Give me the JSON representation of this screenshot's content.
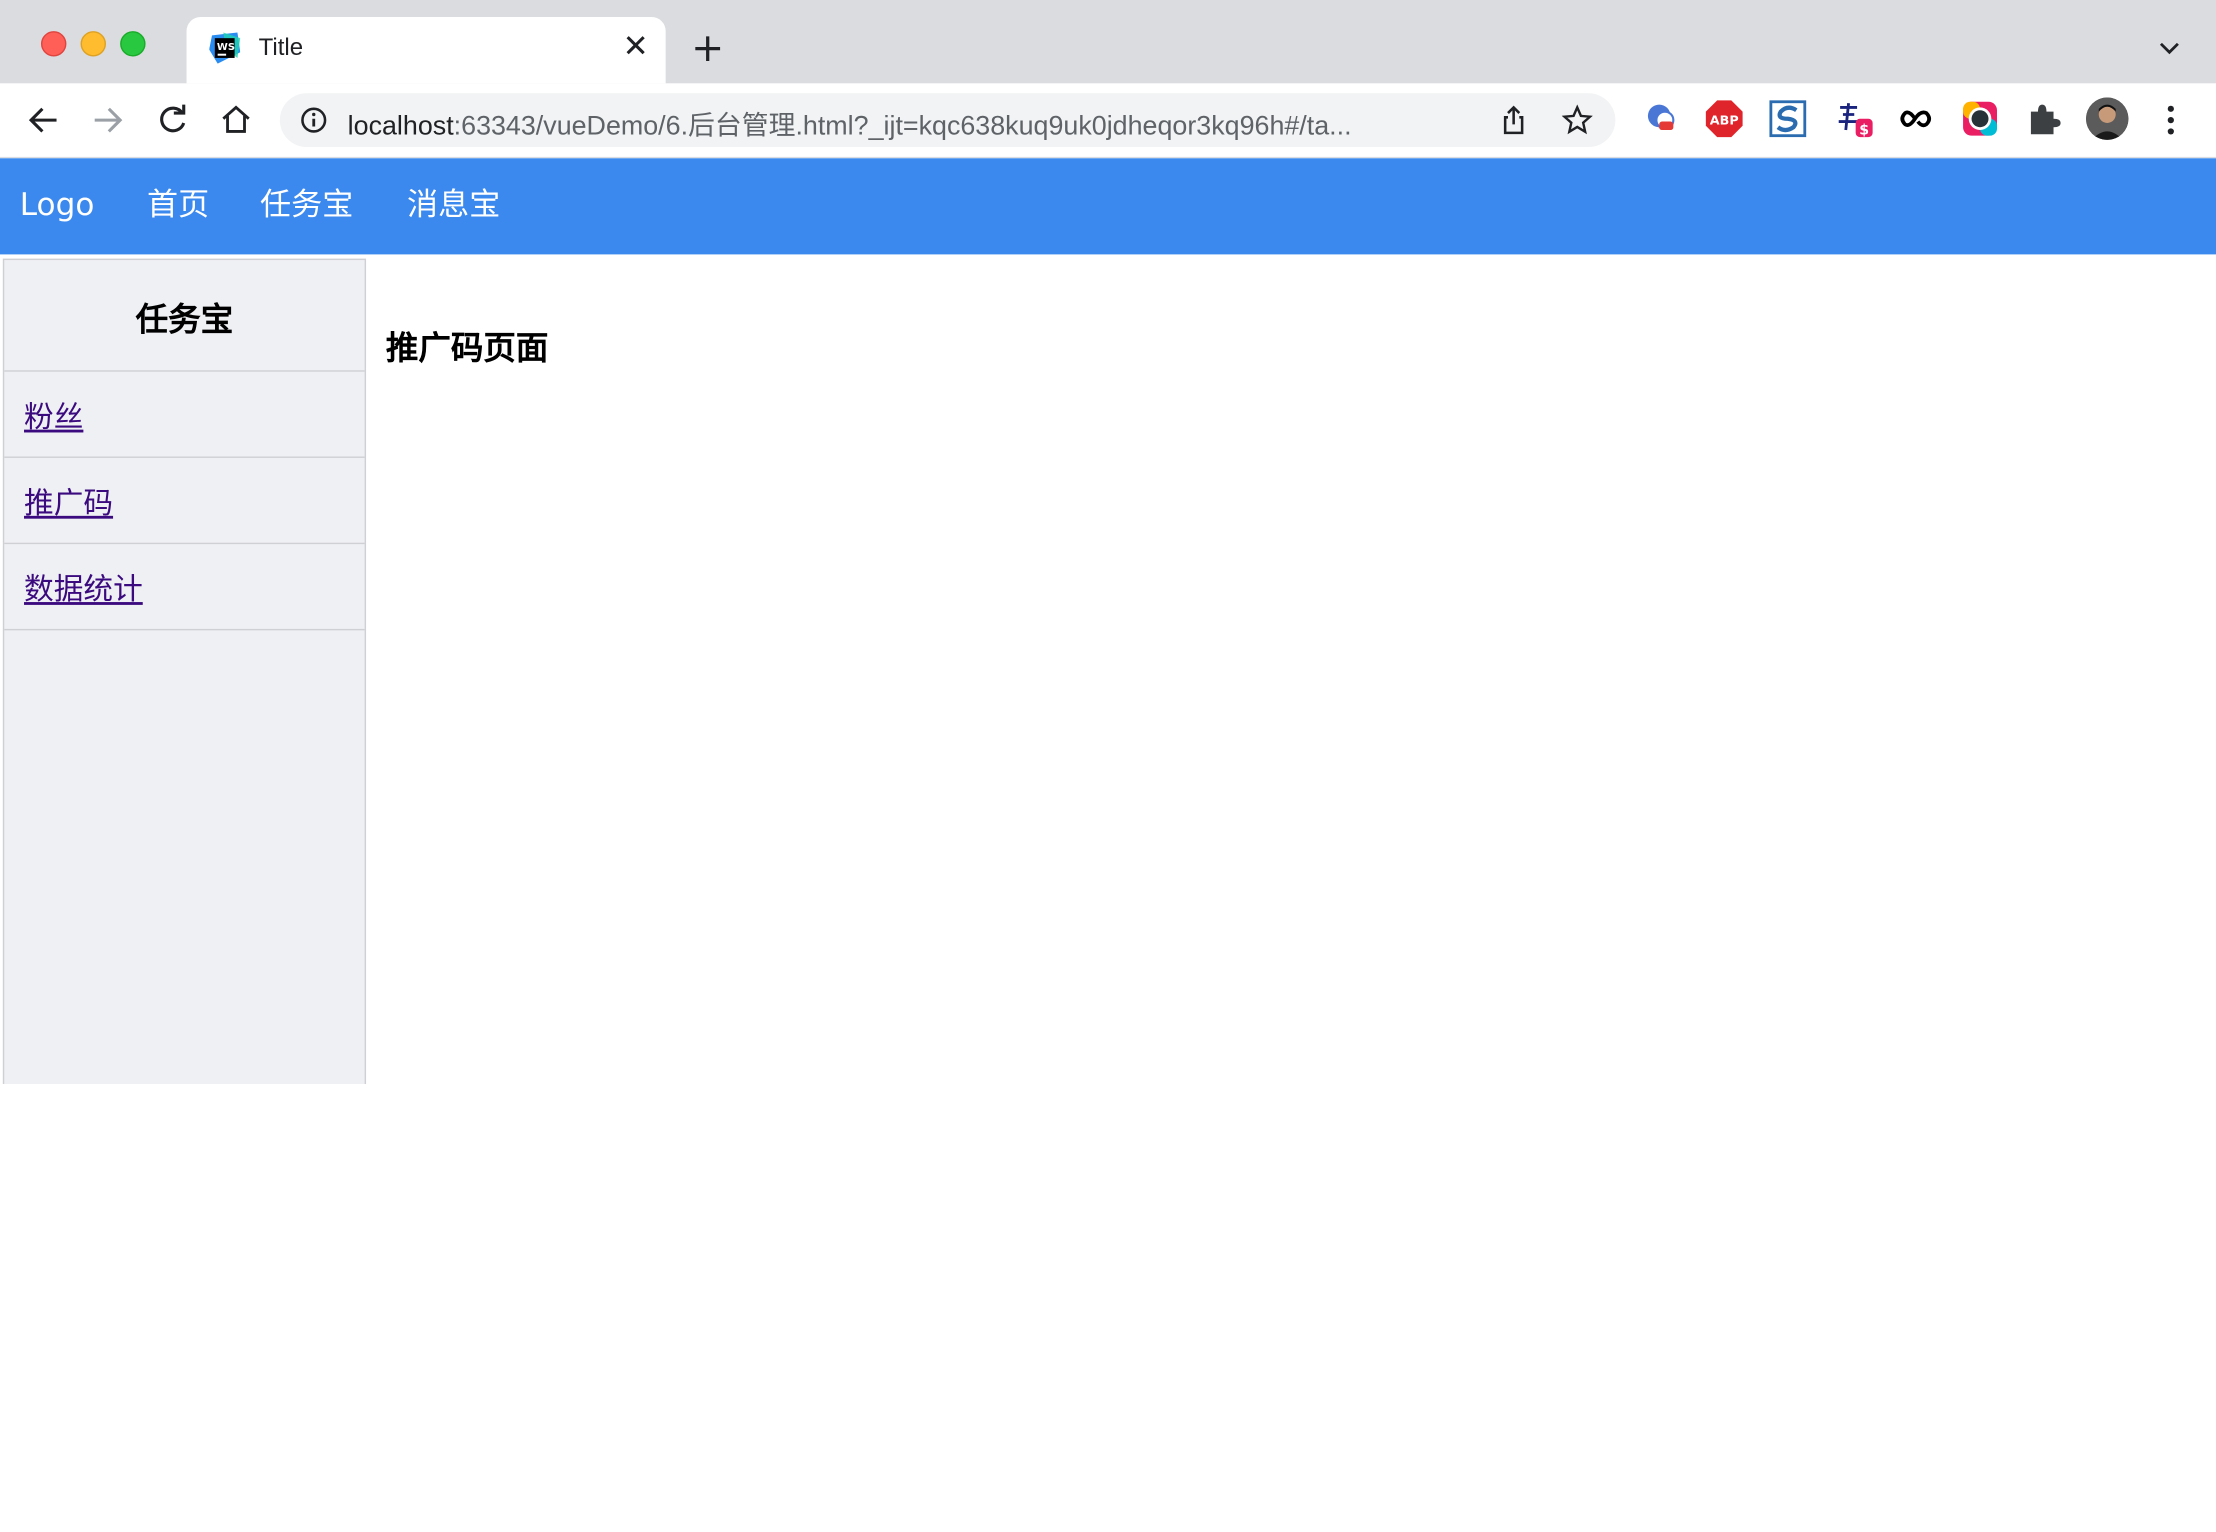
{
  "browser": {
    "tab_title": "Title",
    "tab_close": "✕",
    "new_tab": "+",
    "url_host": "localhost",
    "url_rest": ":63343/vueDemo/6.后台管理.html?_ijt=kqc638kuq9uk0jdheqor3kq96h#/ta...",
    "favicon_text": "WS"
  },
  "navbar": {
    "logo": "Logo",
    "items": [
      {
        "label": "首页"
      },
      {
        "label": "任务宝"
      },
      {
        "label": "消息宝"
      }
    ]
  },
  "sidebar": {
    "title": "任务宝",
    "links": [
      {
        "label": "粉丝"
      },
      {
        "label": "推广码"
      },
      {
        "label": "数据统计"
      }
    ]
  },
  "main": {
    "title": "推广码页面"
  },
  "colors": {
    "navbar_bg": "#3b89ee",
    "sidebar_bg": "#eff0f4",
    "link_color": "#3b0a7e"
  }
}
